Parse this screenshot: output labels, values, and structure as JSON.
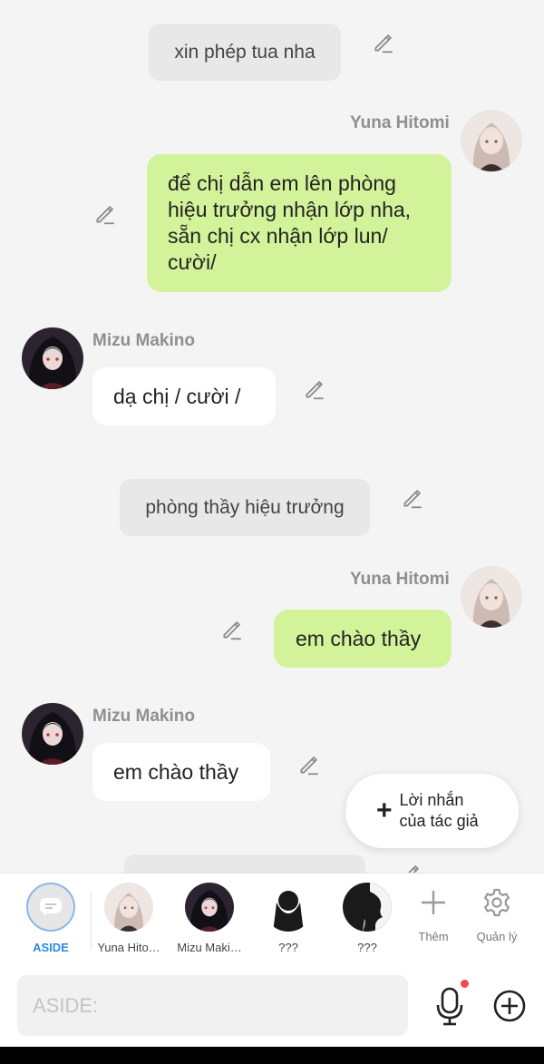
{
  "messages": {
    "narration_1": "xin phép tua nha",
    "yuna_name_1": "Yuna Hitomi",
    "yuna_msg_1": "để chị dẫn em lên phòng hiệu trưởng nhận lớp nha, sẵn chị cx nhận lớp lun/ cười/",
    "mizu_name_1": "Mizu Makino",
    "mizu_msg_1": "dạ chị / cười /",
    "narration_2": "phòng thầy hiệu trưởng",
    "yuna_name_2": "Yuna Hitomi",
    "yuna_msg_2": "em chào thầy",
    "mizu_name_2": "Mizu Makino",
    "mizu_msg_2": "em chào thầy"
  },
  "author_note": {
    "icon": "plus-icon",
    "line1": "Lời nhắn",
    "line2": "của tác giả"
  },
  "character_bar": {
    "aside_label": "ASIDE",
    "yuna_label": "Yuna Hito…",
    "mizu_label": "Mizu Maki…",
    "unknown1_label": "???",
    "unknown2_label": "???",
    "add_label": "Thêm",
    "manage_label": "Quản lý"
  },
  "input": {
    "placeholder": "ASIDE:",
    "value": ""
  },
  "colors": {
    "accent": "#2a8ae0",
    "bubble_right": "#d2f39a",
    "notification_dot": "#f04a4a"
  }
}
